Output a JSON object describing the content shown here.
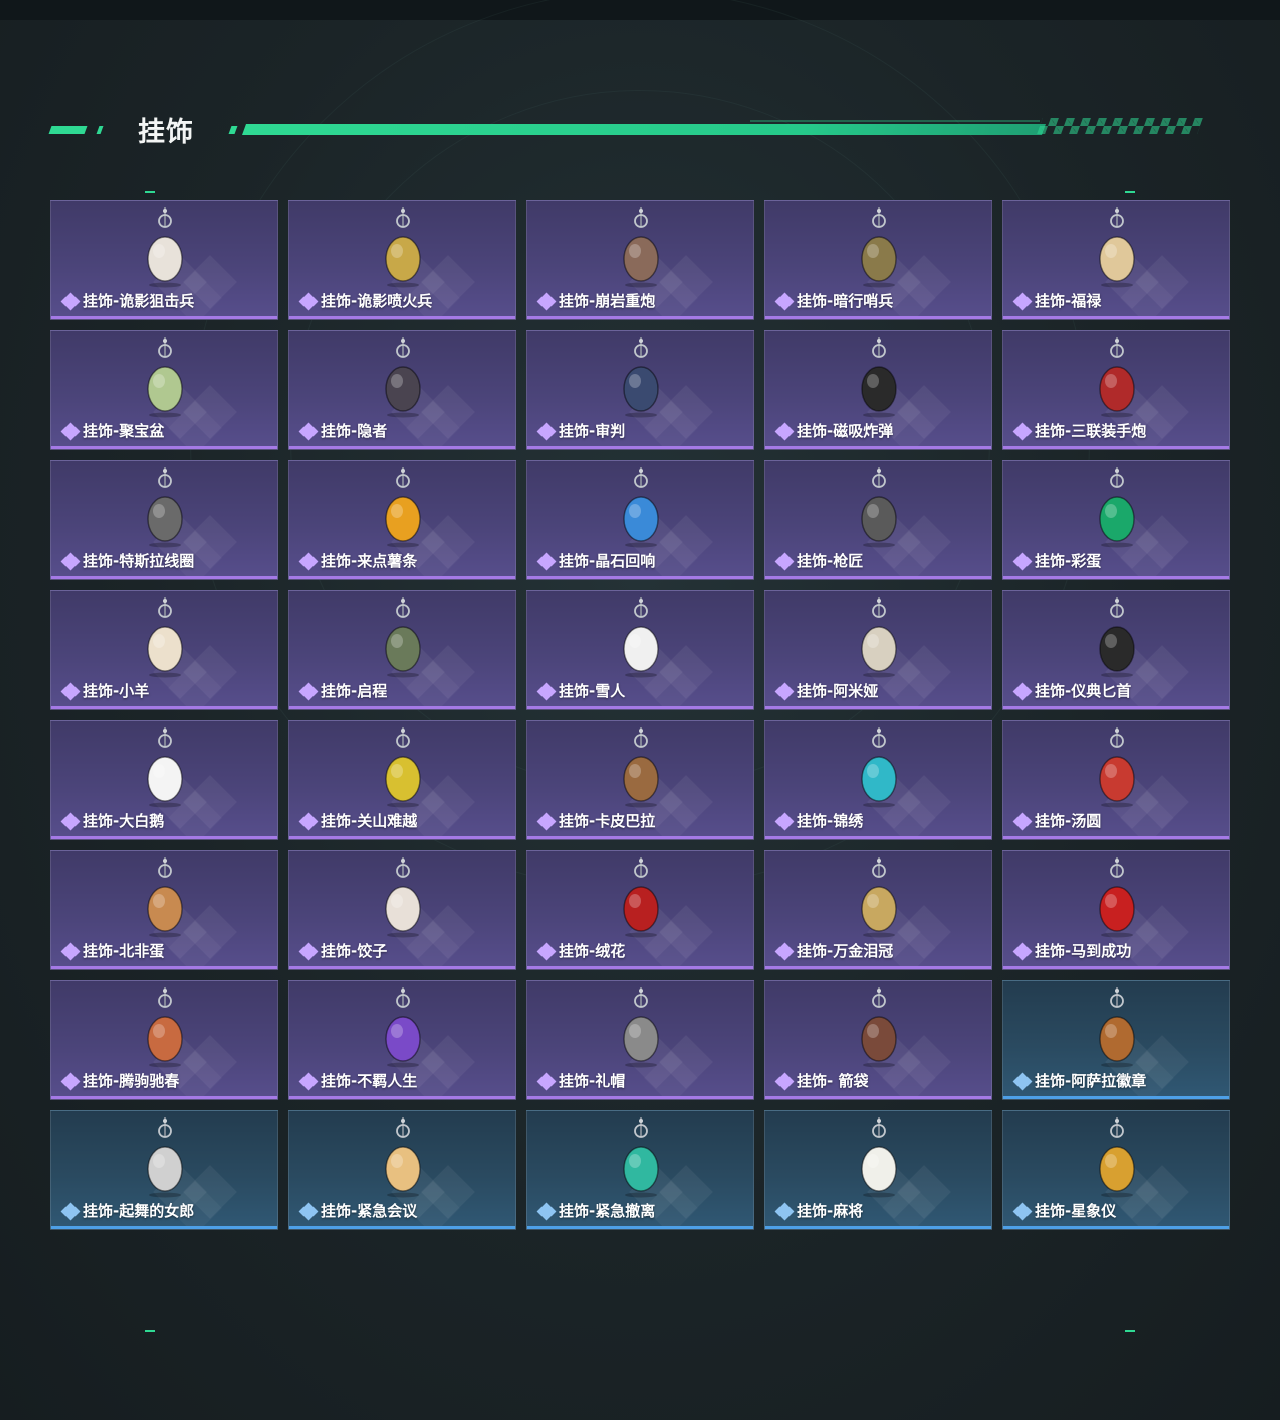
{
  "section": {
    "title": "挂饰",
    "accent_color": "#2fd993"
  },
  "rarity_colors": {
    "purple": "#a57ae6",
    "blue": "#4ea0e8"
  },
  "items": [
    {
      "label": "挂饰-诡影狙击兵",
      "rarity": "purple",
      "icon": "ghost-sniper-charm-icon",
      "color": "#e8e2da"
    },
    {
      "label": "挂饰-诡影喷火兵",
      "rarity": "purple",
      "icon": "ghost-flamethrower-charm-icon",
      "color": "#c8a848"
    },
    {
      "label": "挂饰-崩岩重炮",
      "rarity": "purple",
      "icon": "rock-cannon-charm-icon",
      "color": "#8a6a5a"
    },
    {
      "label": "挂饰-暗行哨兵",
      "rarity": "purple",
      "icon": "shadow-sentry-charm-icon",
      "color": "#8a7a4a"
    },
    {
      "label": "挂饰-福禄",
      "rarity": "purple",
      "icon": "gourd-charm-icon",
      "color": "#e0c89a"
    },
    {
      "label": "挂饰-聚宝盆",
      "rarity": "purple",
      "icon": "treasure-bowl-charm-icon",
      "color": "#b0c890"
    },
    {
      "label": "挂饰-隐者",
      "rarity": "purple",
      "icon": "hermit-card-charm-icon",
      "color": "#4a4450"
    },
    {
      "label": "挂饰-审判",
      "rarity": "purple",
      "icon": "judgement-card-charm-icon",
      "color": "#3a4a70"
    },
    {
      "label": "挂饰-磁吸炸弹",
      "rarity": "purple",
      "icon": "magnetic-bomb-charm-icon",
      "color": "#2a2a2a"
    },
    {
      "label": "挂饰-三联装手炮",
      "rarity": "purple",
      "icon": "triple-hand-cannon-charm-icon",
      "color": "#b02a2a"
    },
    {
      "label": "挂饰-特斯拉线圈",
      "rarity": "purple",
      "icon": "tesla-coil-charm-icon",
      "color": "#6a6a6a"
    },
    {
      "label": "挂饰-来点薯条",
      "rarity": "purple",
      "icon": "fries-charm-icon",
      "color": "#e8a020"
    },
    {
      "label": "挂饰-晶石回响",
      "rarity": "purple",
      "icon": "crystal-echo-charm-icon",
      "color": "#3a8ad8"
    },
    {
      "label": "挂饰-枪匠",
      "rarity": "purple",
      "icon": "gunsmith-charm-icon",
      "color": "#5a5a5a"
    },
    {
      "label": "挂饰-彩蛋",
      "rarity": "purple",
      "icon": "easter-egg-charm-icon",
      "color": "#1aa86a"
    },
    {
      "label": "挂饰-小羊",
      "rarity": "purple",
      "icon": "lamb-charm-icon",
      "color": "#ece0cc"
    },
    {
      "label": "挂饰-启程",
      "rarity": "purple",
      "icon": "departure-medal-charm-icon",
      "color": "#6a7a5a"
    },
    {
      "label": "挂饰-雪人",
      "rarity": "purple",
      "icon": "snowman-charm-icon",
      "color": "#f0f0f0"
    },
    {
      "label": "挂饰-阿米娅",
      "rarity": "purple",
      "icon": "amiya-charm-icon",
      "color": "#d8d0c0"
    },
    {
      "label": "挂饰-仪典匕首",
      "rarity": "purple",
      "icon": "ceremonial-dagger-charm-icon",
      "color": "#2a2a2a"
    },
    {
      "label": "挂饰-大白鹅",
      "rarity": "purple",
      "icon": "white-goose-charm-icon",
      "color": "#f4f4f4"
    },
    {
      "label": "挂饰-关山难越",
      "rarity": "purple",
      "icon": "gold-bar-charm-icon",
      "color": "#d8c030"
    },
    {
      "label": "挂饰-卡皮巴拉",
      "rarity": "purple",
      "icon": "capybara-charm-icon",
      "color": "#9a6a40"
    },
    {
      "label": "挂饰-锦绣",
      "rarity": "purple",
      "icon": "butterfly-charm-icon",
      "color": "#30b8c8"
    },
    {
      "label": "挂饰-汤圆",
      "rarity": "purple",
      "icon": "rice-ball-charm-icon",
      "color": "#c83a30"
    },
    {
      "label": "挂饰-北非蛋",
      "rarity": "purple",
      "icon": "shakshuka-charm-icon",
      "color": "#c88a50"
    },
    {
      "label": "挂饰-饺子",
      "rarity": "purple",
      "icon": "dumpling-charm-icon",
      "color": "#e8e0d8"
    },
    {
      "label": "挂饰-绒花",
      "rarity": "purple",
      "icon": "velvet-flower-charm-icon",
      "color": "#b82020"
    },
    {
      "label": "挂饰-万金泪冠",
      "rarity": "purple",
      "icon": "burger-crown-charm-icon",
      "color": "#c8a860"
    },
    {
      "label": "挂饰-马到成功",
      "rarity": "purple",
      "icon": "lucky-horse-charm-icon",
      "color": "#c82020"
    },
    {
      "label": "挂饰-腾驹驰春",
      "rarity": "purple",
      "icon": "carriage-charm-icon",
      "color": "#c86a40"
    },
    {
      "label": "挂饰-不羁人生",
      "rarity": "purple",
      "icon": "sneaker-charm-icon",
      "color": "#7a4ac8"
    },
    {
      "label": "挂饰-礼帽",
      "rarity": "purple",
      "icon": "fedora-charm-icon",
      "color": "#8a8a8a"
    },
    {
      "label": "挂饰- 箭袋",
      "rarity": "purple",
      "icon": "quiver-charm-icon",
      "color": "#7a4a3a"
    },
    {
      "label": "挂饰-阿萨拉徽章",
      "rarity": "blue",
      "icon": "asala-badge-charm-icon",
      "color": "#b06a30"
    },
    {
      "label": "挂饰-起舞的女郎",
      "rarity": "blue",
      "icon": "dancing-lady-charm-icon",
      "color": "#d0d0d0"
    },
    {
      "label": "挂饰-紧急会议",
      "rarity": "blue",
      "icon": "emergency-meeting-charm-icon",
      "color": "#e8c080"
    },
    {
      "label": "挂饰-紧急撤离",
      "rarity": "blue",
      "icon": "emergency-evac-charm-icon",
      "color": "#30b8a0"
    },
    {
      "label": "挂饰-麻将",
      "rarity": "blue",
      "icon": "mahjong-tile-charm-icon",
      "color": "#f0f0ea"
    },
    {
      "label": "挂饰-星象仪",
      "rarity": "blue",
      "icon": "astrolabe-charm-icon",
      "color": "#d8a030"
    }
  ]
}
